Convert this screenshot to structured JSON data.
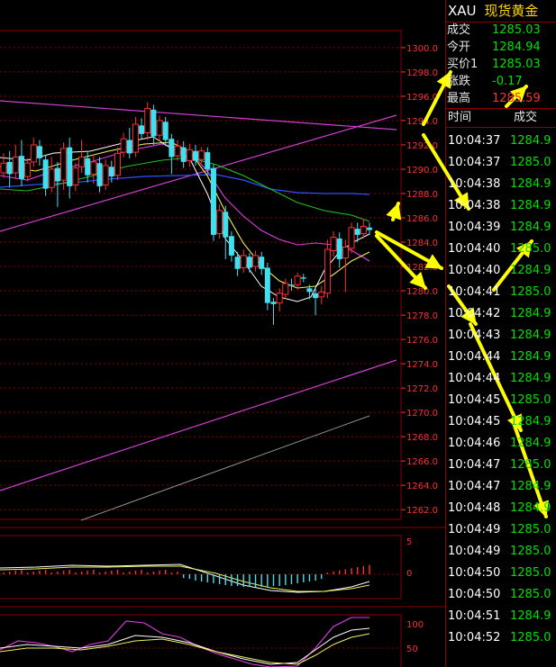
{
  "instrument": {
    "code": "XAU",
    "name": "现货黄金"
  },
  "quote": [
    {
      "label": "成交",
      "value": "1285.03",
      "color": "#00e000"
    },
    {
      "label": "今开",
      "value": "1284.94",
      "color": "#00e000"
    },
    {
      "label": "买价1",
      "value": "1285.03",
      "color": "#00e000"
    },
    {
      "label": "涨跌",
      "value": "-0.17",
      "color": "#00e000"
    },
    {
      "label": "最高",
      "value": "1285.59",
      "color": "#ff3030"
    }
  ],
  "ticks_header": {
    "time": "时间",
    "price": "成交"
  },
  "ticks": [
    {
      "time": "10:04:37",
      "price": "1284.9"
    },
    {
      "time": "10:04:37",
      "price": "1285.0"
    },
    {
      "time": "10:04:38",
      "price": "1284.9"
    },
    {
      "time": "10:04:38",
      "price": "1284.9"
    },
    {
      "time": "10:04:39",
      "price": "1284.9"
    },
    {
      "time": "10:04:40",
      "price": "1285.0"
    },
    {
      "time": "10:04:40",
      "price": "1284.9"
    },
    {
      "time": "10:04:41",
      "price": "1285.0"
    },
    {
      "time": "10:04:42",
      "price": "1284.9"
    },
    {
      "time": "10:04:43",
      "price": "1284.9"
    },
    {
      "time": "10:04:44",
      "price": "1284.9"
    },
    {
      "time": "10:04:44",
      "price": "1284.9"
    },
    {
      "time": "10:04:45",
      "price": "1285.0"
    },
    {
      "time": "10:04:45",
      "price": "1284.9"
    },
    {
      "time": "10:04:46",
      "price": "1284.9"
    },
    {
      "time": "10:04:47",
      "price": "1285.0"
    },
    {
      "time": "10:04:47",
      "price": "1284.9"
    },
    {
      "time": "10:04:48",
      "price": "1284.9"
    },
    {
      "time": "10:04:49",
      "price": "1285.0"
    },
    {
      "time": "10:04:49",
      "price": "1285.0"
    },
    {
      "time": "10:04:50",
      "price": "1285.0"
    },
    {
      "time": "10:04:50",
      "price": "1285.0"
    },
    {
      "time": "10:04:51",
      "price": "1284.9"
    },
    {
      "time": "10:04:52",
      "price": "1285.0"
    }
  ],
  "chart_data": {
    "type": "candlestick",
    "price_axis_ticks": [
      "1300.0",
      "1298.0",
      "1296.0",
      "1294.0",
      "1292.0",
      "1290.0",
      "1288.0",
      "1286.0",
      "1284.0",
      "1282.0",
      "1280.0",
      "1278.0",
      "1276.0",
      "1274.0",
      "1272.0",
      "1270.0",
      "1268.0",
      "1266.0",
      "1264.0",
      "1262.0"
    ],
    "price_range": [
      1261.2,
      1301.4
    ],
    "macd_axis_ticks": [
      "5",
      "0"
    ],
    "kdj_axis_ticks": [
      "100",
      "50"
    ],
    "candles": [
      {
        "o": 1289.7,
        "c": 1290.5,
        "h": 1291.3,
        "l": 1289.3
      },
      {
        "o": 1290.6,
        "c": 1289.6,
        "h": 1291.5,
        "l": 1288.5
      },
      {
        "o": 1289.7,
        "c": 1291.0,
        "h": 1292.0,
        "l": 1289.2
      },
      {
        "o": 1291.1,
        "c": 1289.2,
        "h": 1292.4,
        "l": 1288.6
      },
      {
        "o": 1289.4,
        "c": 1290.5,
        "h": 1290.9,
        "l": 1289.0
      },
      {
        "o": 1290.6,
        "c": 1292.0,
        "h": 1292.6,
        "l": 1290.2
      },
      {
        "o": 1291.9,
        "c": 1290.9,
        "h": 1292.4,
        "l": 1290.3
      },
      {
        "o": 1290.8,
        "c": 1288.4,
        "h": 1291.2,
        "l": 1287.8
      },
      {
        "o": 1288.5,
        "c": 1290.0,
        "h": 1291.0,
        "l": 1288.1
      },
      {
        "o": 1290.1,
        "c": 1289.0,
        "h": 1290.6,
        "l": 1286.9
      },
      {
        "o": 1289.1,
        "c": 1291.7,
        "h": 1292.2,
        "l": 1288.3
      },
      {
        "o": 1291.8,
        "c": 1288.6,
        "h": 1292.6,
        "l": 1287.6
      },
      {
        "o": 1288.7,
        "c": 1290.1,
        "h": 1290.5,
        "l": 1288.2
      },
      {
        "o": 1290.2,
        "c": 1291.0,
        "h": 1292.4,
        "l": 1289.7
      },
      {
        "o": 1290.9,
        "c": 1289.5,
        "h": 1291.4,
        "l": 1288.9
      },
      {
        "o": 1289.6,
        "c": 1290.6,
        "h": 1291.2,
        "l": 1288.8
      },
      {
        "o": 1290.5,
        "c": 1288.6,
        "h": 1291.0,
        "l": 1288.1
      },
      {
        "o": 1288.7,
        "c": 1290.3,
        "h": 1290.8,
        "l": 1288.3
      },
      {
        "o": 1290.2,
        "c": 1289.4,
        "h": 1290.7,
        "l": 1288.9
      },
      {
        "o": 1289.5,
        "c": 1291.3,
        "h": 1291.8,
        "l": 1289.1
      },
      {
        "o": 1291.4,
        "c": 1292.5,
        "h": 1293.0,
        "l": 1291.0
      },
      {
        "o": 1292.4,
        "c": 1291.3,
        "h": 1293.4,
        "l": 1290.9
      },
      {
        "o": 1291.4,
        "c": 1293.7,
        "h": 1294.3,
        "l": 1291.0
      },
      {
        "o": 1293.6,
        "c": 1292.9,
        "h": 1294.2,
        "l": 1292.5
      },
      {
        "o": 1293.0,
        "c": 1295.0,
        "h": 1295.5,
        "l": 1292.4
      },
      {
        "o": 1294.9,
        "c": 1292.7,
        "h": 1295.3,
        "l": 1292.0
      },
      {
        "o": 1292.8,
        "c": 1294.0,
        "h": 1294.4,
        "l": 1292.3
      },
      {
        "o": 1293.9,
        "c": 1292.4,
        "h": 1294.3,
        "l": 1291.9
      },
      {
        "o": 1292.5,
        "c": 1291.0,
        "h": 1292.9,
        "l": 1289.6
      },
      {
        "o": 1291.1,
        "c": 1291.9,
        "h": 1292.4,
        "l": 1290.7
      },
      {
        "o": 1291.8,
        "c": 1290.6,
        "h": 1292.3,
        "l": 1290.1
      },
      {
        "o": 1290.7,
        "c": 1291.6,
        "h": 1292.1,
        "l": 1290.2
      },
      {
        "o": 1291.5,
        "c": 1290.7,
        "h": 1292.0,
        "l": 1290.3
      },
      {
        "o": 1290.8,
        "c": 1291.5,
        "h": 1291.8,
        "l": 1290.5
      },
      {
        "o": 1291.4,
        "c": 1290.0,
        "h": 1291.8,
        "l": 1289.6
      },
      {
        "o": 1290.1,
        "c": 1284.6,
        "h": 1290.4,
        "l": 1284.1
      },
      {
        "o": 1284.7,
        "c": 1286.6,
        "h": 1287.1,
        "l": 1284.3
      },
      {
        "o": 1286.5,
        "c": 1284.4,
        "h": 1287.0,
        "l": 1282.6
      },
      {
        "o": 1284.5,
        "c": 1282.9,
        "h": 1284.9,
        "l": 1282.4
      },
      {
        "o": 1282.8,
        "c": 1281.8,
        "h": 1283.2,
        "l": 1281.2
      },
      {
        "o": 1281.9,
        "c": 1282.9,
        "h": 1283.4,
        "l": 1281.5
      },
      {
        "o": 1282.8,
        "c": 1281.9,
        "h": 1283.1,
        "l": 1281.5
      },
      {
        "o": 1282.0,
        "c": 1282.9,
        "h": 1283.3,
        "l": 1281.6
      },
      {
        "o": 1282.8,
        "c": 1281.8,
        "h": 1283.2,
        "l": 1281.3
      },
      {
        "o": 1281.9,
        "c": 1279.0,
        "h": 1282.3,
        "l": 1278.4
      },
      {
        "o": 1279.1,
        "c": 1278.9,
        "h": 1279.4,
        "l": 1277.2
      },
      {
        "o": 1279.0,
        "c": 1279.8,
        "h": 1280.2,
        "l": 1278.3
      },
      {
        "o": 1279.7,
        "c": 1280.6,
        "h": 1281.0,
        "l": 1279.3
      },
      {
        "o": 1280.5,
        "c": 1280.4,
        "h": 1281.0,
        "l": 1280.0
      },
      {
        "o": 1280.5,
        "c": 1281.2,
        "h": 1281.5,
        "l": 1280.1
      },
      {
        "o": 1281.1,
        "c": 1281.0,
        "h": 1281.4,
        "l": 1280.7
      },
      {
        "o": 1280.2,
        "c": 1279.9,
        "h": 1280.5,
        "l": 1279.3
      },
      {
        "o": 1279.8,
        "c": 1279.4,
        "h": 1280.3,
        "l": 1278.0
      },
      {
        "o": 1279.5,
        "c": 1279.9,
        "h": 1280.4,
        "l": 1278.9
      },
      {
        "o": 1279.8,
        "c": 1283.4,
        "h": 1284.2,
        "l": 1279.4
      },
      {
        "o": 1283.3,
        "c": 1284.4,
        "h": 1284.9,
        "l": 1282.8
      },
      {
        "o": 1284.3,
        "c": 1282.6,
        "h": 1284.8,
        "l": 1281.9
      },
      {
        "o": 1282.7,
        "c": 1283.6,
        "h": 1284.2,
        "l": 1279.9
      },
      {
        "o": 1283.5,
        "c": 1285.2,
        "h": 1285.6,
        "l": 1283.1
      },
      {
        "o": 1285.1,
        "c": 1284.6,
        "h": 1285.6,
        "l": 1284.0
      },
      {
        "o": 1284.7,
        "c": 1285.3,
        "h": 1285.9,
        "l": 1284.3
      },
      {
        "o": 1285.2,
        "c": 1285.0,
        "h": 1285.6,
        "l": 1284.6
      }
    ],
    "colors": {
      "up": "#ff3030",
      "down": "#40e0f0",
      "grid": "#8b0000",
      "axis_text": "#ff3030"
    }
  }
}
